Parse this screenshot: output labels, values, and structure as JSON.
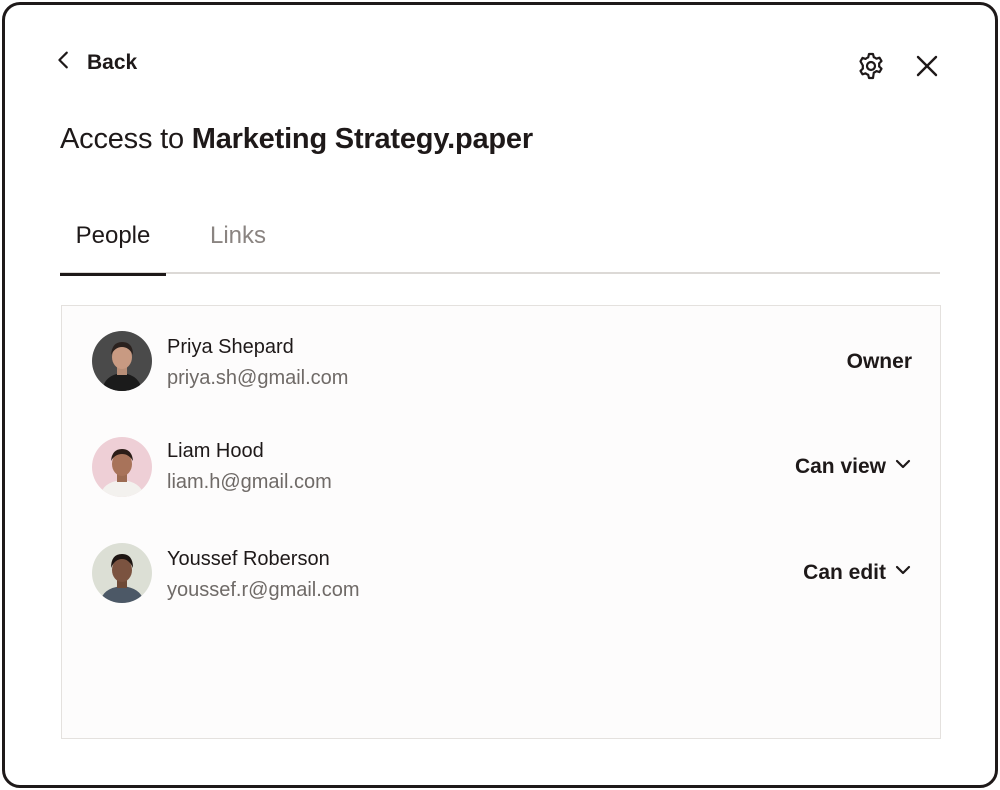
{
  "header": {
    "back_label": "Back",
    "title_prefix": "Access to ",
    "file_name": "Marketing Strategy.paper"
  },
  "tabs": [
    {
      "label": "People",
      "active": true
    },
    {
      "label": "Links",
      "active": false
    }
  ],
  "people": [
    {
      "name": "Priya Shepard",
      "email": "priya.sh@gmail.com",
      "role": "Owner",
      "role_editable": false
    },
    {
      "name": "Liam Hood",
      "email": "liam.h@gmail.com",
      "role": "Can view",
      "role_editable": true
    },
    {
      "name": "Youssef Roberson",
      "email": "youssef.r@gmail.com",
      "role": "Can edit",
      "role_editable": true
    }
  ],
  "colors": {
    "text": "#1e1919",
    "muted": "#6f6a67",
    "inactive_tab": "#8a8481",
    "border": "#dcd9d6"
  },
  "icons": {
    "back": "chevron-left-icon",
    "settings": "gear-icon",
    "close": "close-icon",
    "dropdown": "chevron-down-icon"
  }
}
